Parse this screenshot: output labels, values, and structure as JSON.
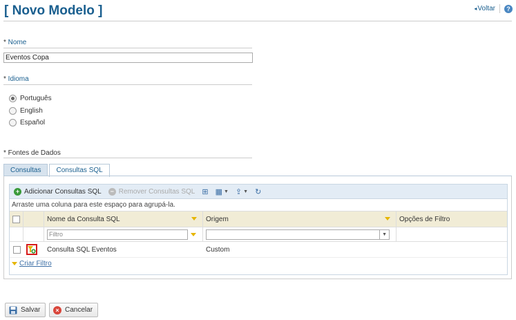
{
  "header": {
    "title": "[ Novo Modelo ]",
    "back_label": "Voltar"
  },
  "fields": {
    "nome": {
      "label": "Nome",
      "value": "Eventos Copa"
    },
    "idioma": {
      "label": "Idioma",
      "options": [
        "Português",
        "English",
        "Español"
      ],
      "selected": "Português"
    },
    "fontes": {
      "label": "Fontes de Dados"
    }
  },
  "tabs": [
    "Consultas",
    "Consultas SQL"
  ],
  "active_tab": "Consultas SQL",
  "grid": {
    "toolbar": {
      "add": "Adicionar Consultas SQL",
      "remove": "Remover Consultas SQL"
    },
    "group_hint": "Arraste uma coluna para este espaço para agrupá-la.",
    "columns": [
      "Nome da Consulta SQL",
      "Origem",
      "Opções de Filtro"
    ],
    "filter_placeholder": "Filtro",
    "rows": [
      {
        "name": "Consulta SQL Eventos",
        "origin": "Custom"
      }
    ],
    "create_filter": "Criar Filtro"
  },
  "buttons": {
    "save": "Salvar",
    "cancel": "Cancelar"
  },
  "colors": {
    "title": "#1a5f8f",
    "header_row": "#f1ecd6",
    "toolbar": "#e3ecf5",
    "highlight": "#d61c1c"
  }
}
